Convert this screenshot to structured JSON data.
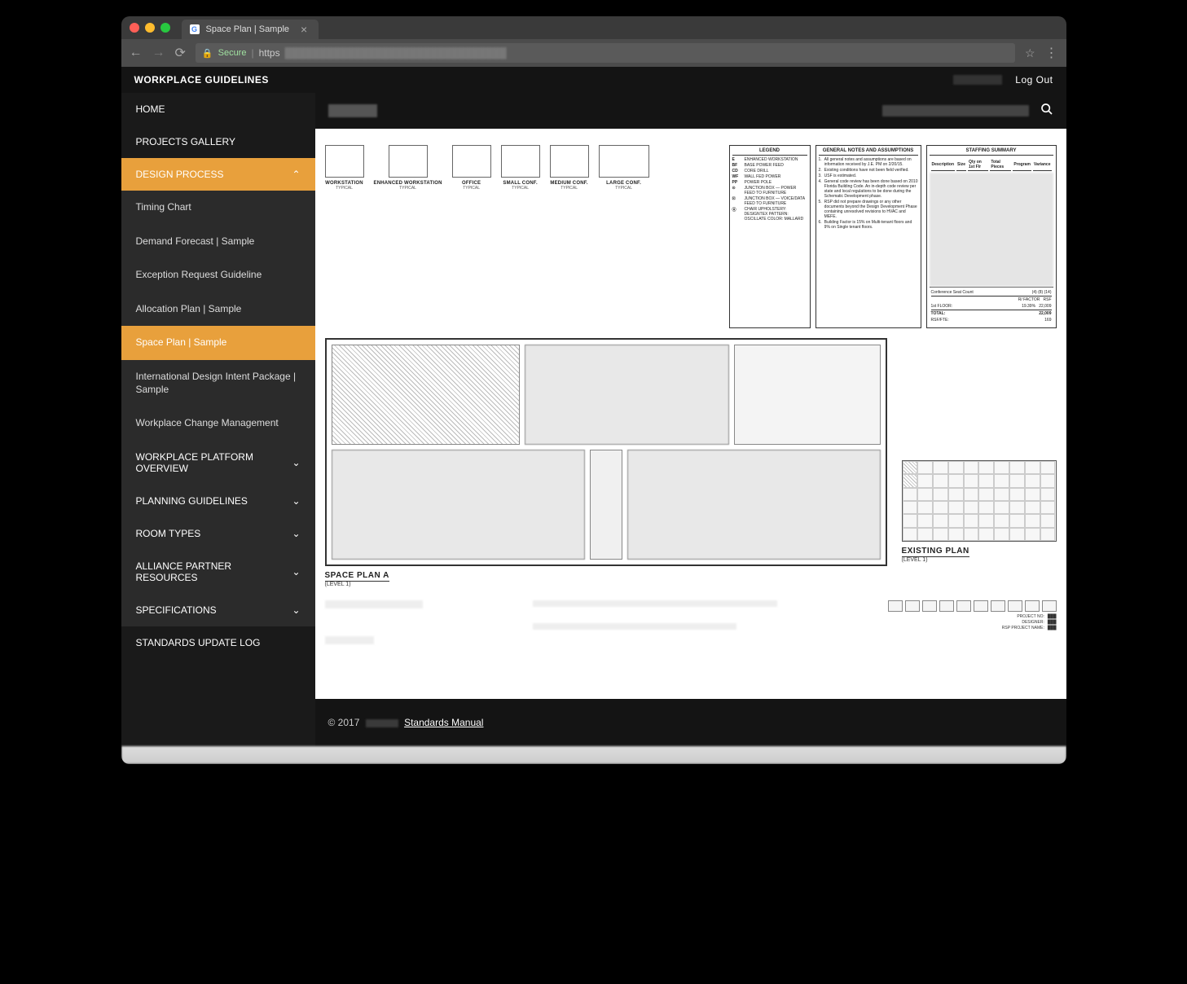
{
  "browser": {
    "tab_title": "Space Plan | Sample",
    "secure_label": "Secure",
    "protocol": "https"
  },
  "topbar": {
    "site_title": "WORKPLACE GUIDELINES",
    "logout": "Log Out"
  },
  "sidebar": {
    "items": [
      {
        "label": "HOME",
        "type": "top"
      },
      {
        "label": "PROJECTS GALLERY",
        "type": "top"
      },
      {
        "label": "DESIGN PROCESS",
        "type": "top",
        "open": true,
        "children": [
          {
            "label": "Timing Chart"
          },
          {
            "label": "Demand Forecast | Sample"
          },
          {
            "label": "Exception Request Guideline"
          },
          {
            "label": "Allocation Plan | Sample"
          },
          {
            "label": "Space Plan | Sample",
            "active": true
          },
          {
            "label": "International Design Intent Package | Sample"
          },
          {
            "label": "Workplace Change Management"
          }
        ]
      },
      {
        "label": "WORKPLACE PLATFORM OVERVIEW",
        "type": "top",
        "chev": true
      },
      {
        "label": "PLANNING GUIDELINES",
        "type": "top",
        "chev": true
      },
      {
        "label": "ROOM TYPES",
        "type": "top",
        "chev": true
      },
      {
        "label": "ALLIANCE PARTNER RESOURCES",
        "type": "top",
        "chev": true
      },
      {
        "label": "SPECIFICATIONS",
        "type": "top",
        "chev": true
      },
      {
        "label": "STANDARDS UPDATE LOG",
        "type": "top"
      }
    ]
  },
  "doc": {
    "thumbs": [
      {
        "label": "WORKSTATION",
        "sub": "TYPICAL"
      },
      {
        "label": "ENHANCED WORKSTATION",
        "sub": "TYPICAL"
      },
      {
        "label": "OFFICE",
        "sub": "TYPICAL"
      },
      {
        "label": "SMALL CONF.",
        "sub": "TYPICAL"
      },
      {
        "label": "MEDIUM CONF.",
        "sub": "TYPICAL"
      },
      {
        "label": "LARGE CONF.",
        "sub": "TYPICAL"
      }
    ],
    "legend": {
      "title": "LEGEND",
      "items": [
        {
          "k": "E",
          "v": "ENHANCED WORKSTATION"
        },
        {
          "k": "BF",
          "v": "BASE POWER FEED"
        },
        {
          "k": "CD",
          "v": "CORE DRILL"
        },
        {
          "k": "WF",
          "v": "WALL FED POWER"
        },
        {
          "k": "PP",
          "v": "POWER POLE"
        },
        {
          "k": "⊙",
          "v": "JUNCTION BOX — POWER FEED TO FURNITURE"
        },
        {
          "k": "⊡",
          "v": "JUNCTION BOX — VOICE/DATA FEED TO FURNITURE"
        },
        {
          "k": "Ⓐ",
          "v": "CHAIR UPHOLSTERY: DESIGNTEX PATTERN: OSCILLATE COLOR: MALLARD"
        }
      ]
    },
    "notes": {
      "title": "GENERAL NOTES AND ASSUMPTIONS",
      "lines": [
        "All general notes and assumptions are based on information received by J.E. PM on 2/20/15.",
        "Existing conditions have not been field verified.",
        "USF is estimated.",
        "General code review has been done based on 2010 Florida Building Code. An in-depth code review per state and local regulations to be done during the Schematic Development phase.",
        "RSP did not prepare drawings or any other documents beyond the Design Development Phase containing unresolved revisions to HVAC and MEFE.",
        "Building Factor is 15% on Multi-tenant floors and 9% on Single tenant floors."
      ]
    },
    "staffing": {
      "title": "STAFFING SUMMARY",
      "headers": [
        "Description",
        "Size",
        "Qty on 1st Flr",
        "Total Pieces",
        "Program",
        "Variance"
      ],
      "conference_row_label": "Conference Seat Count",
      "conference_cols": [
        "(4)",
        "(8)",
        "(14)"
      ],
      "floor_label": "1st FLOOR:",
      "floor_pct": "19.39%",
      "floor_val": "22,009",
      "totals_label": "TOTAL:",
      "totals_val": "22,009",
      "rsf_label": "RSF/FTE:",
      "rsf_val": "169",
      "rfactor_label": "R/ FACTOR",
      "rsf_head": "RSF"
    },
    "plan_a_title": "SPACE PLAN A",
    "plan_a_sub": "(LEVEL 1)",
    "existing_title": "EXISTING PLAN",
    "existing_sub": "(LEVEL 1)",
    "titleblock": {
      "project_label": "PROJECT NO:",
      "designer_label": "DESIGNER:",
      "rsp_label": "RSP PROJECT NAME:"
    }
  },
  "footer": {
    "copyright": "© 2017",
    "link": "Standards Manual"
  }
}
